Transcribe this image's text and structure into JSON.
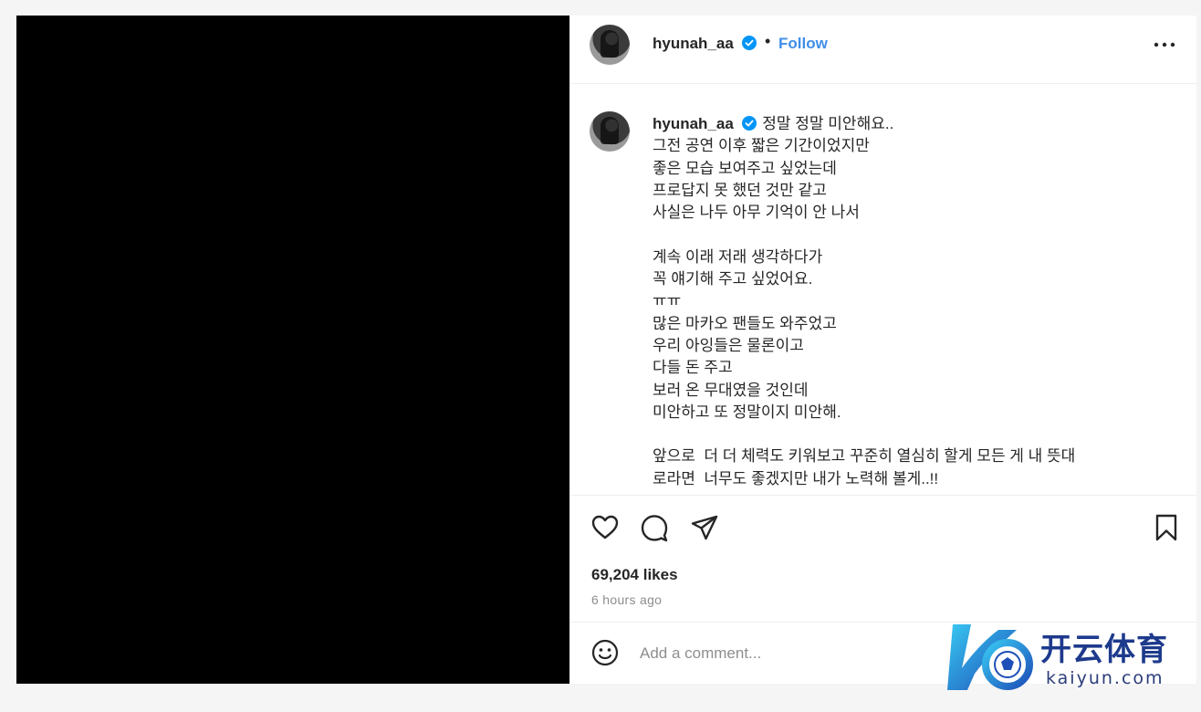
{
  "post": {
    "username": "hyunah_aa",
    "verified": true,
    "follow_label": "Follow",
    "separator": "•",
    "more_icon": "more-horizontal-icon"
  },
  "caption": {
    "username": "hyunah_aa",
    "first_line": "정말 정말 미안해요..",
    "lines": [
      "그전 공연 이후 짧은 기간이었지만",
      "좋은 모습 보여주고 싶었는데",
      "프로답지 못 했던 것만 같고",
      "사실은 나두 아무 기억이 안 나서",
      "",
      "계속 이래 저래 생각하다가",
      "꼭 얘기해 주고 싶었어요.",
      "ㅠㅠ",
      "많은 마카오 팬들도 와주었고",
      "우리 아잉들은 물론이고",
      "다들 돈 주고",
      "보러 온 무대였을 것인데",
      "미안하고 또 정말이지 미안해.",
      "",
      "앞으로  더 더 체력도 키워보고 꾸준히 열심히 할게 모든 게 내 뜻대",
      "로라면  너무도 좋겠지만 내가 노력해 볼게..!!"
    ]
  },
  "actions": {
    "like_icon": "heart-icon",
    "comment_icon": "comment-icon",
    "share_icon": "send-icon",
    "save_icon": "bookmark-icon",
    "likes": "69,204 likes",
    "time": "6 hours ago"
  },
  "comment_box": {
    "emoji_icon": "emoji-icon",
    "placeholder": "Add a comment..."
  },
  "watermark": {
    "title": "开云体育",
    "subtitle": "kaiyun.com"
  },
  "colors": {
    "link_blue": "#3f8ee8",
    "verified_blue": "#0095f6",
    "muted": "#8e8e8e",
    "text": "#262626"
  }
}
